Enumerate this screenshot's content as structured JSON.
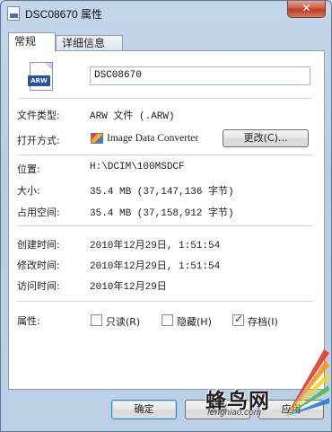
{
  "window": {
    "title": "DSC08670 属性",
    "close_label": "✕"
  },
  "tabs": [
    {
      "label": "常规",
      "active": true
    },
    {
      "label": "详细信息",
      "active": false
    }
  ],
  "general": {
    "file_icon_badge": "ARW",
    "file_name": "DSC08670",
    "file_type_label": "文件类型:",
    "file_type_value": "ARW 文件 (.ARW)",
    "opens_with_label": "打开方式:",
    "opens_with_value": "Image Data Converter",
    "change_button": "更改(C)...",
    "location_label": "位置:",
    "location_value": "H:\\DCIM\\100MSDCF",
    "size_label": "大小:",
    "size_value": "35.4 MB (37,147,136 字节)",
    "size_on_disk_label": "占用空间:",
    "size_on_disk_value": "35.4 MB (37,158,912 字节)",
    "created_label": "创建时间:",
    "created_value": "2010年12月29日, 1:51:54",
    "modified_label": "修改时间:",
    "modified_value": "2010年12月29日, 1:51:54",
    "accessed_label": "访问时间:",
    "accessed_value": "2010年12月29日",
    "attributes_label": "属性:",
    "attributes": [
      {
        "label": "只读(R)",
        "checked": false
      },
      {
        "label": "隐藏(H)",
        "checked": false
      },
      {
        "label": "存档(I)",
        "checked": true
      }
    ]
  },
  "buttons": {
    "ok": "确定",
    "cancel": "取消",
    "apply": "应用"
  },
  "watermark": {
    "text": "蜂鸟网",
    "url": "fengniao.com"
  },
  "icons": {
    "file": "arw-file-icon",
    "title": "file-properties-icon",
    "open_with": "image-data-converter-icon"
  },
  "colors": {
    "window_frame": "#b8cde4",
    "close_button": "#c8503a",
    "badge": "#29529a"
  }
}
